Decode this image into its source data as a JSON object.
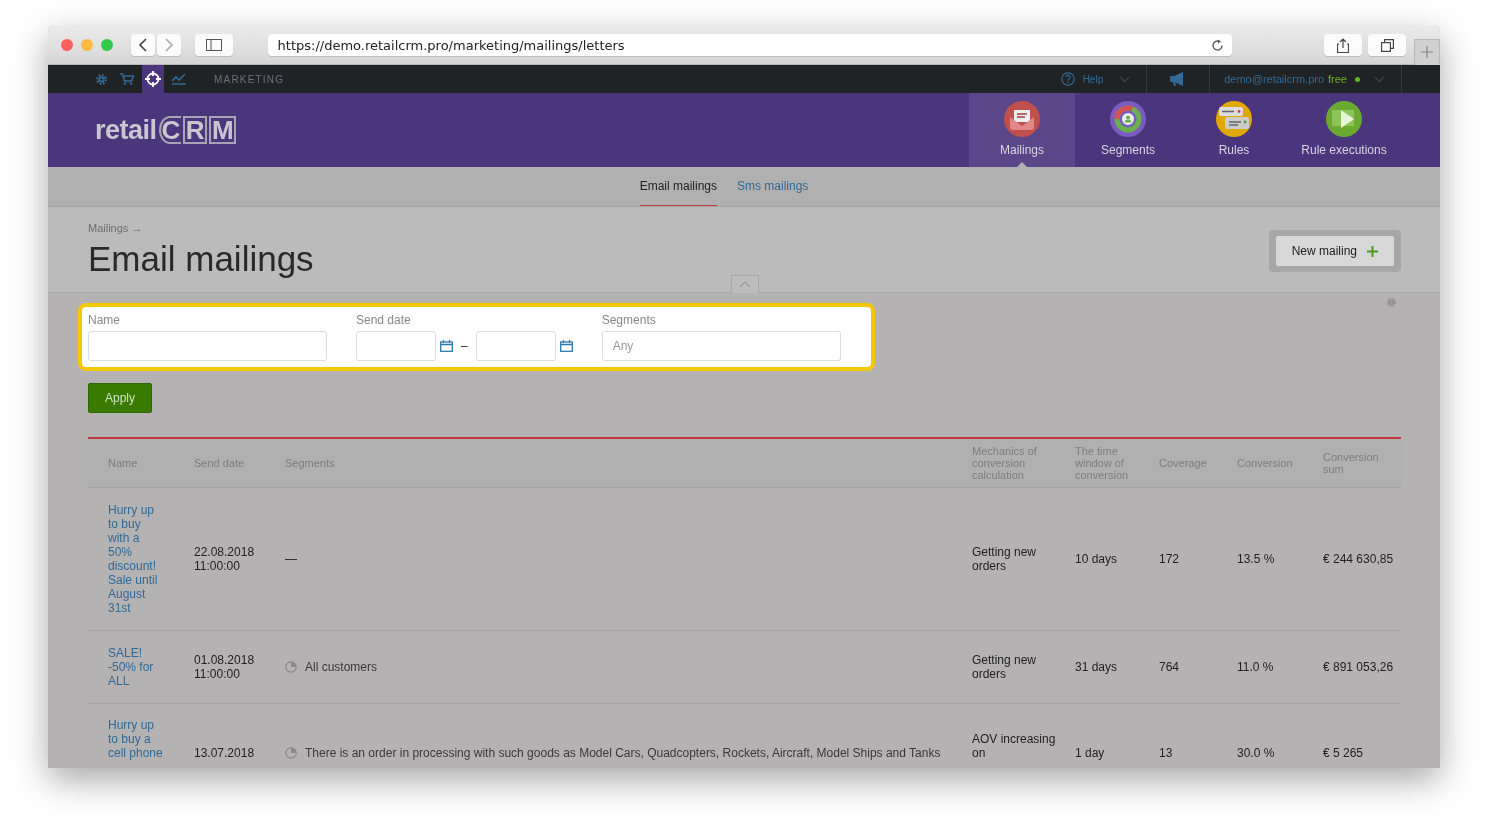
{
  "browser": {
    "url": "https://demo.retailcrm.pro/marketing/mailings/letters"
  },
  "topbar": {
    "sections": [
      {
        "kind": "settings",
        "selected": false
      },
      {
        "kind": "cart",
        "selected": false
      },
      {
        "kind": "marketing",
        "selected": true
      },
      {
        "kind": "analytics",
        "selected": false
      }
    ],
    "section_label": "MARKETING",
    "help": "Help",
    "user": "demo@retailcrm.pro",
    "plan": "free"
  },
  "logo": {
    "word": "retail",
    "letters": [
      "C",
      "R",
      "M"
    ]
  },
  "modules": [
    {
      "label": "Mailings",
      "kind": "mailings",
      "selected": true
    },
    {
      "label": "Segments",
      "kind": "segments",
      "selected": false
    },
    {
      "label": "Rules",
      "kind": "rules",
      "selected": false
    },
    {
      "label": "Rule executions",
      "kind": "executions",
      "selected": false
    }
  ],
  "subtabs": [
    {
      "label": "Email mailings",
      "selected": true
    },
    {
      "label": "Sms mailings",
      "selected": false
    }
  ],
  "breadcrumb": "Mailings →",
  "title": "Email mailings",
  "new_button": "New mailing",
  "filters": {
    "fields": [
      {
        "label": "Name",
        "kind": "text"
      },
      {
        "label": "Send date",
        "kind": "date_range"
      },
      {
        "label": "Segments",
        "kind": "select",
        "placeholder": "Any"
      }
    ],
    "separator": "–",
    "apply": "Apply"
  },
  "table": {
    "columns": [
      "Name",
      "Send date",
      "Segments",
      "Mechanics of conversion calculation",
      "The time window of conversion",
      "Coverage",
      "Conversion",
      "Conversion sum"
    ],
    "rows": [
      {
        "name": "Hurry up to buy with a 50% discount! Sale until August 31st",
        "send_date": "22.08.2018 11:00:00",
        "segment": "—",
        "segment_icon": false,
        "mechanics": "Getting new orders",
        "window": "10 days",
        "coverage": "172",
        "conversion": "13.5 %",
        "sum": "€ 244 630,85"
      },
      {
        "name": "SALE! -50% for ALL",
        "send_date": "01.08.2018 11:00:00",
        "segment": "All customers",
        "segment_icon": true,
        "mechanics": "Getting new orders",
        "window": "31 days",
        "coverage": "764",
        "conversion": "11.0 %",
        "sum": "€ 891 053,26"
      },
      {
        "name": "Hurry up to buy a cell phone",
        "send_date": "13.07.2018",
        "segment": "There is an order in processing with such goods as Model Cars, Quadcopters, Rockets, Aircraft, Model Ships and Tanks",
        "segment_icon": true,
        "mechanics": "AOV increasing on",
        "window": "1 day",
        "coverage": "13",
        "conversion": "30.0 %",
        "sum": "€ 5 265"
      }
    ]
  }
}
